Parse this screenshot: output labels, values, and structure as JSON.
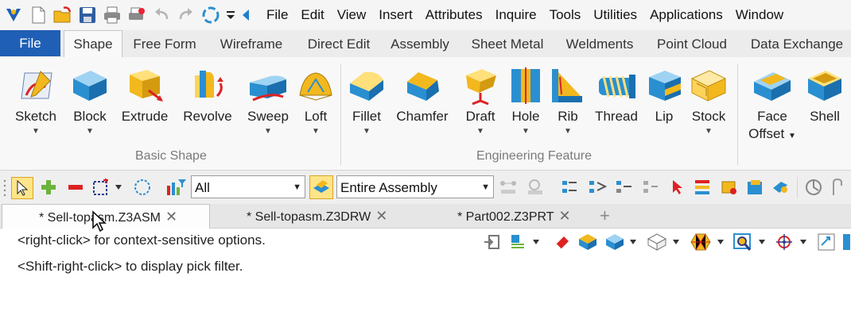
{
  "menu": {
    "items": [
      "File",
      "Edit",
      "View",
      "Insert",
      "Attributes",
      "Inquire",
      "Tools",
      "Utilities",
      "Applications",
      "Window"
    ]
  },
  "quick_access_icons": [
    "app-logo-icon",
    "new-file-icon",
    "open-folder-icon",
    "save-icon",
    "print-icon",
    "print-preview-icon",
    "undo-icon",
    "redo-icon",
    "refresh-icon",
    "customize-dropdown-icon",
    "collapse-arrow-icon"
  ],
  "ribbon_tabs": [
    "File",
    "Shape",
    "Free Form",
    "Wireframe",
    "Direct Edit",
    "Assembly",
    "Sheet Metal",
    "Weldments",
    "Point Cloud",
    "Data Exchange"
  ],
  "active_tab": "Shape",
  "basic_shape": {
    "label": "Basic Shape",
    "buttons": [
      "Sketch",
      "Block",
      "Extrude",
      "Revolve",
      "Sweep",
      "Loft"
    ]
  },
  "engineering_feature": {
    "label": "Engineering Feature",
    "buttons": [
      "Fillet",
      "Chamfer",
      "Draft",
      "Hole",
      "Rib",
      "Thread",
      "Lip",
      "Stock"
    ]
  },
  "other_buttons": {
    "face_offset_line1": "Face",
    "face_offset_line2": "Offset",
    "shell": "Shell"
  },
  "filter": {
    "type_value": "All",
    "scope_value": "Entire Assembly"
  },
  "document_tabs": [
    "* Sell-topasm.Z3ASM",
    "* Sell-topasm.Z3DRW",
    "* Part002.Z3PRT"
  ],
  "active_document": "* Sell-topasm.Z3ASM",
  "viewport": {
    "hint_line1": "<right-click> for context-sensitive options.",
    "hint_line2": "<Shift-right-click> to display pick filter."
  },
  "colors": {
    "accent_blue": "#1f5fb5",
    "feature_gold": "#f2b81e",
    "feature_blue": "#2a8fd0"
  }
}
